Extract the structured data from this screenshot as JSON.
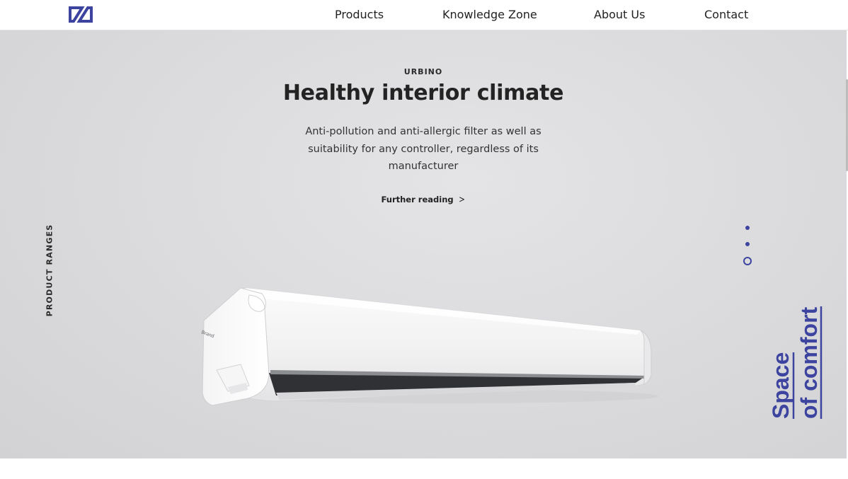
{
  "header": {
    "logo_icon": "brand-logo-icon",
    "nav": [
      {
        "label": "Products"
      },
      {
        "label": "Knowledge Zone"
      },
      {
        "label": "About Us"
      },
      {
        "label": "Contact"
      }
    ]
  },
  "hero": {
    "eyebrow": "URBINO",
    "title": "Healthy interior climate",
    "description": "Anti-pollution and anti-allergic filter as well as suitability for any controller, regardless of its manufacturer",
    "link_label": "Further reading",
    "link_icon": "chevron-right-icon",
    "side_label": "PRODUCT RANGES",
    "tagline_line1": "Space",
    "tagline_line2": "of comfort",
    "slides": {
      "count": 3,
      "active": 3
    }
  },
  "colors": {
    "accent": "#3d44a0",
    "hero_bg": "#dcdcde",
    "text": "#232323"
  }
}
